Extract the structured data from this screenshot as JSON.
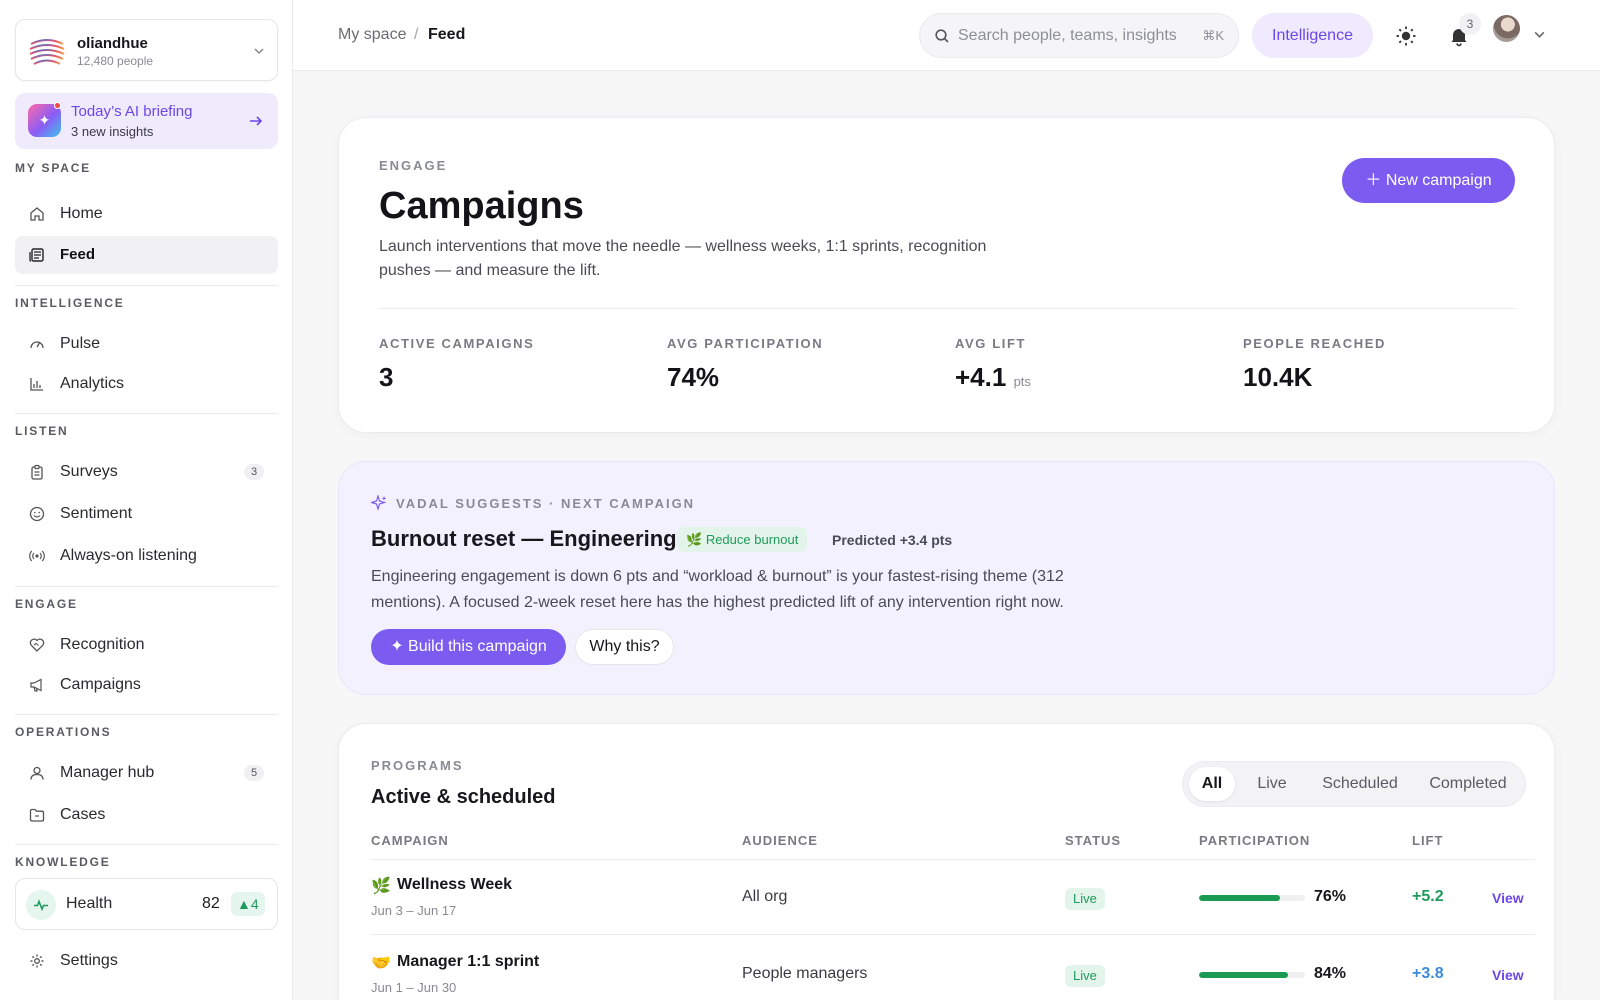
{
  "org": {
    "name": "oliandhue",
    "count": "12,480 people"
  },
  "briefing": {
    "title": "Today’s AI briefing",
    "sub": "3 new insights"
  },
  "nav": {
    "my_space": "MY SPACE",
    "home": "Home",
    "feed": "Feed",
    "intelligence": "INTELLIGENCE",
    "pulse": "Pulse",
    "analytics": "Analytics",
    "listen": "LISTEN",
    "surveys": "Surveys",
    "surveys_count": "3",
    "sentiment": "Sentiment",
    "always_on": "Always-on listening",
    "engage": "ENGAGE",
    "recognition": "Recognition",
    "campaigns": "Campaigns",
    "operations": "OPERATIONS",
    "manager_hub": "Manager hub",
    "manager_hub_count": "5",
    "cases": "Cases",
    "knowledge": "KNOWLEDGE",
    "health": "Health",
    "health_value": "82",
    "health_delta": "4",
    "settings": "Settings"
  },
  "topbar": {
    "crumb_root": "My space",
    "crumb_sep": "/",
    "crumb_current": "Feed",
    "search_placeholder": "Search people, teams, insights",
    "search_shortcut": "⌘K",
    "intelligence_label": "Intelligence",
    "notif_count": "3"
  },
  "hero": {
    "eyebrow": "ENGAGE",
    "title": "Campaigns",
    "desc": "Launch interventions that move the needle — wellness weeks, 1:1 sprints, recognition pushes — and measure the lift.",
    "new_button": "New campaign",
    "stats": [
      {
        "label": "ACTIVE CAMPAIGNS",
        "value": "3",
        "unit": ""
      },
      {
        "label": "AVG PARTICIPATION",
        "value": "74%",
        "unit": ""
      },
      {
        "label": "AVG LIFT",
        "value": "+4.1",
        "unit": "pts"
      },
      {
        "label": "PEOPLE REACHED",
        "value": "10.4K",
        "unit": ""
      }
    ]
  },
  "suggest": {
    "eyebrow": "VADAL SUGGESTS · NEXT CAMPAIGN",
    "title": "Burnout reset — Engineering",
    "tag": "Reduce burnout",
    "predicted": "Predicted +3.4 pts",
    "body": "Engineering engagement is down 6 pts and “workload & burnout” is your fastest-rising theme (312 mentions). A focused 2-week reset here has the highest predicted lift of any intervention right now.",
    "build_button": "Build this campaign",
    "why_button": "Why this?"
  },
  "programs": {
    "eyebrow": "PROGRAMS",
    "title": "Active & scheduled",
    "filters": [
      "All",
      "Live",
      "Scheduled",
      "Completed"
    ],
    "active_filter": "All",
    "columns": [
      "CAMPAIGN",
      "AUDIENCE",
      "STATUS",
      "PARTICIPATION",
      "LIFT"
    ],
    "rows": [
      {
        "emoji": "🌿",
        "name": "Wellness Week",
        "dates": "Jun 3 – Jun 17",
        "audience": "All org",
        "status": "Live",
        "participation": 0.76,
        "participation_label": "76%",
        "lift": "+5.2",
        "lift_color": "#1f9a5c",
        "action": "View"
      },
      {
        "emoji": "🤝",
        "name": "Manager 1:1 sprint",
        "dates": "Jun 1 – Jun 30",
        "audience": "People managers",
        "status": "Live",
        "participation": 0.84,
        "participation_label": "84%",
        "lift": "+3.8",
        "lift_color": "#3b8bd9",
        "action": "View"
      }
    ]
  },
  "colors": {
    "accent": "#7c5cf0",
    "success": "#1f9a5c",
    "lift_blue": "#3b8bd9"
  }
}
